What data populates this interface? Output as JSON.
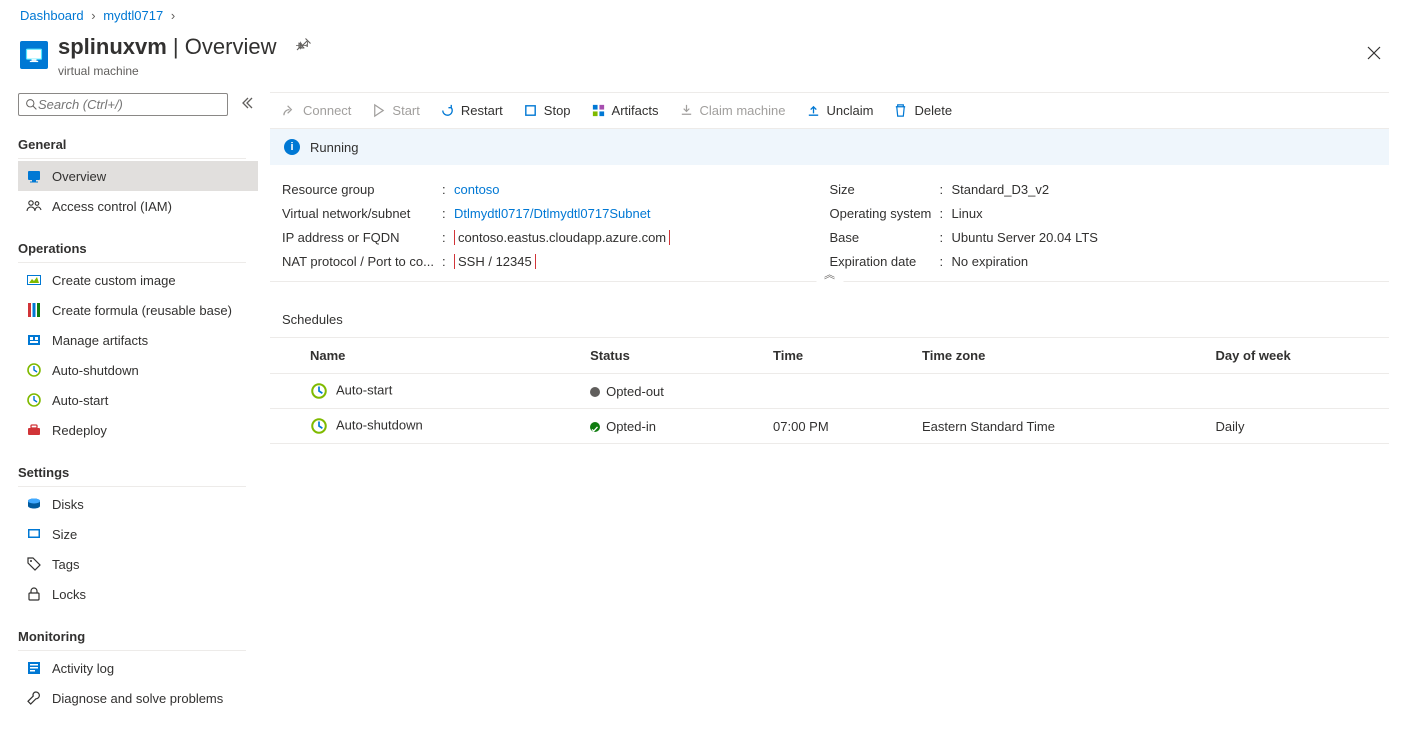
{
  "breadcrumb": [
    {
      "label": "Dashboard",
      "href": "#"
    },
    {
      "label": "mydtl0717",
      "href": "#"
    }
  ],
  "header": {
    "title": "splinuxvm",
    "section": "Overview",
    "subtitle": "virtual machine"
  },
  "search": {
    "placeholder": "Search (Ctrl+/)"
  },
  "sidebar": {
    "general": {
      "heading": "General",
      "items": [
        {
          "label": "Overview"
        },
        {
          "label": "Access control (IAM)"
        }
      ]
    },
    "operations": {
      "heading": "Operations",
      "items": [
        {
          "label": "Create custom image"
        },
        {
          "label": "Create formula (reusable base)"
        },
        {
          "label": "Manage artifacts"
        },
        {
          "label": "Auto-shutdown"
        },
        {
          "label": "Auto-start"
        },
        {
          "label": "Redeploy"
        }
      ]
    },
    "settings": {
      "heading": "Settings",
      "items": [
        {
          "label": "Disks"
        },
        {
          "label": "Size"
        },
        {
          "label": "Tags"
        },
        {
          "label": "Locks"
        }
      ]
    },
    "monitoring": {
      "heading": "Monitoring",
      "items": [
        {
          "label": "Activity log"
        },
        {
          "label": "Diagnose and solve problems"
        }
      ]
    }
  },
  "toolbar": {
    "connect": "Connect",
    "start": "Start",
    "restart": "Restart",
    "stop": "Stop",
    "artifacts": "Artifacts",
    "claim": "Claim machine",
    "unclaim": "Unclaim",
    "delete": "Delete"
  },
  "status": "Running",
  "props_left": [
    {
      "key": "Resource group",
      "val": "contoso",
      "link": true
    },
    {
      "key": "Virtual network/subnet",
      "val": "Dtlmydtl0717/Dtlmydtl0717Subnet",
      "link": true
    },
    {
      "key": "IP address or FQDN",
      "val": "contoso.eastus.cloudapp.azure.com",
      "hl": true
    },
    {
      "key": "NAT protocol / Port to co...",
      "val": "SSH / 12345",
      "hl": true
    }
  ],
  "props_right": [
    {
      "key": "Size",
      "val": "Standard_D3_v2"
    },
    {
      "key": "Operating system",
      "val": "Linux"
    },
    {
      "key": "Base",
      "val": "Ubuntu Server 20.04 LTS"
    },
    {
      "key": "Expiration date",
      "val": "No expiration"
    }
  ],
  "schedules": {
    "heading": "Schedules",
    "cols": [
      "Name",
      "Status",
      "Time",
      "Time zone",
      "Day of week"
    ],
    "rows": [
      {
        "name": "Auto-start",
        "status": "Opted-out",
        "status_color": "gray",
        "time": "",
        "tz": "",
        "dow": ""
      },
      {
        "name": "Auto-shutdown",
        "status": "Opted-in",
        "status_color": "green",
        "time": "07:00 PM",
        "tz": "Eastern Standard Time",
        "dow": "Daily"
      }
    ]
  }
}
